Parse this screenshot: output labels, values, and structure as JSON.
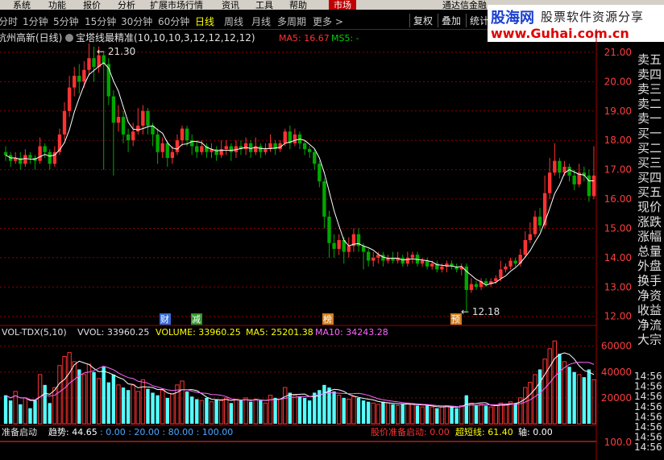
{
  "menu": {
    "items": [
      "系统",
      "功能",
      "报价",
      "分析",
      "扩展市场行情",
      "资讯",
      "工具",
      "帮助"
    ],
    "active_item": "市场",
    "account_text": "通达信金融"
  },
  "periods": {
    "items": [
      "分时",
      "1分钟",
      "5分钟",
      "15分钟",
      "30分钟",
      "60分钟",
      "日线",
      "周线",
      "月线",
      "多周期",
      "更多 >"
    ],
    "active": "日线"
  },
  "toolbar": {
    "buttons": [
      "复权",
      "叠加",
      "统计"
    ]
  },
  "logo": {
    "site": "股海网",
    "slogan": "股票软件资源分享",
    "url": "www.Guhai.com.cn"
  },
  "main": {
    "stock_title": "杭州高新(日线)",
    "indicator_name": "宝塔线最精准(10,10,10,3,12,12,12,12)",
    "ma5_text": "MA5: 16.67",
    "ms5_text": "MS5: -",
    "high_label": "21.30",
    "low_label": "12.18",
    "markers": [
      "财",
      "减",
      "榜",
      "预"
    ]
  },
  "vol": {
    "title": "VOL-TDX(5,10)",
    "vvol": "VVOL: 33960.25",
    "volume": "VOLUME: 33960.25",
    "ma5": "MA5: 25201.38",
    "ma10": "MA10: 34243.28"
  },
  "bottom": {
    "name": "准备启动",
    "trend": "趋势: 44.65",
    "levels": ": 0.00 : 20.00 : 80.00 : 100.00",
    "price_start": "股价准备启动: 0.00",
    "short_line": "超短线: 61.40",
    "axis": "轴: 0.00"
  },
  "sidebar": {
    "items": [
      "卖五",
      "卖四",
      "卖三",
      "卖二",
      "卖一",
      "买一",
      "买二",
      "买三",
      "买四",
      "买五",
      "现价",
      "涨跌",
      "涨幅",
      "总量",
      "外盘",
      "换手",
      "净资",
      "收益",
      "净流",
      "大宗"
    ],
    "times": [
      "14:56",
      "14:56",
      "14:56",
      "14:56",
      "14:56",
      "14:56",
      "14:56",
      "14:56"
    ]
  },
  "colors": {
    "up": "#ff3232",
    "down": "#00a800",
    "ma": "#ffffff",
    "grid": "#8b0000",
    "axis_text": "#ff3c3c",
    "vol_up": "#ff3232",
    "vol_down": "#54ffff"
  },
  "chart_data": {
    "type": "candlestick",
    "price_ticks": [
      21.0,
      20.0,
      19.0,
      18.0,
      17.0,
      16.0,
      15.0,
      14.0,
      13.0,
      12.0
    ],
    "price_range": [
      11.8,
      21.3
    ],
    "volume_ticks": [
      60000,
      40000,
      20000
    ],
    "volume_range": [
      0,
      66000
    ],
    "bottom_ticks": [
      "100.0"
    ],
    "candles": [
      [
        17.6,
        17.5,
        17.8,
        17.3
      ],
      [
        17.5,
        17.3,
        17.6,
        17.1
      ],
      [
        17.3,
        17.4,
        17.6,
        17.2
      ],
      [
        17.4,
        17.2,
        17.6,
        17.0
      ],
      [
        17.2,
        17.5,
        17.7,
        17.1
      ],
      [
        17.5,
        17.4,
        17.6,
        17.2
      ],
      [
        17.4,
        17.3,
        17.5,
        17.0
      ],
      [
        17.3,
        17.8,
        18.1,
        17.2
      ],
      [
        17.8,
        17.6,
        17.9,
        17.4
      ],
      [
        17.6,
        17.2,
        17.7,
        17.0
      ],
      [
        17.2,
        17.6,
        17.8,
        17.1
      ],
      [
        17.6,
        18.2,
        18.4,
        17.5
      ],
      [
        18.2,
        19.0,
        19.3,
        18.0
      ],
      [
        19.0,
        19.8,
        20.2,
        18.8
      ],
      [
        19.8,
        20.2,
        20.5,
        19.5
      ],
      [
        20.2,
        20.0,
        20.6,
        19.6
      ],
      [
        20.0,
        20.4,
        20.7,
        19.8
      ],
      [
        20.4,
        20.8,
        21.3,
        20.2
      ],
      [
        20.8,
        20.5,
        21.2,
        20.0
      ],
      [
        20.5,
        20.9,
        21.2,
        20.3
      ],
      [
        20.9,
        20.6,
        21.0,
        17.0
      ],
      [
        20.6,
        19.5,
        20.8,
        19.2
      ],
      [
        19.5,
        18.6,
        19.7,
        16.8
      ],
      [
        18.6,
        18.8,
        19.2,
        18.3
      ],
      [
        18.8,
        18.2,
        19.0,
        17.9
      ],
      [
        18.2,
        18.0,
        18.4,
        17.6
      ],
      [
        18.0,
        18.3,
        18.6,
        17.8
      ],
      [
        18.3,
        18.5,
        19.1,
        18.2
      ],
      [
        18.5,
        19.0,
        19.2,
        18.2
      ],
      [
        19.0,
        18.5,
        19.1,
        18.2
      ],
      [
        18.5,
        18.2,
        18.6,
        17.8
      ],
      [
        18.2,
        17.6,
        18.4,
        17.2
      ],
      [
        17.6,
        17.9,
        18.1,
        17.4
      ],
      [
        17.9,
        17.4,
        18.0,
        17.1
      ],
      [
        17.4,
        17.6,
        17.8,
        17.2
      ],
      [
        17.6,
        18.0,
        18.2,
        17.5
      ],
      [
        18.0,
        18.4,
        18.5,
        17.8
      ],
      [
        18.4,
        18.0,
        18.5,
        17.8
      ],
      [
        18.0,
        17.8,
        18.2,
        17.5
      ],
      [
        17.8,
        17.6,
        18.0,
        17.4
      ],
      [
        17.6,
        17.8,
        18.0,
        17.5
      ],
      [
        17.8,
        17.6,
        17.9,
        17.4
      ],
      [
        17.6,
        17.7,
        17.9,
        17.4
      ],
      [
        17.7,
        17.5,
        17.8,
        17.3
      ],
      [
        17.5,
        17.7,
        18.0,
        17.4
      ],
      [
        17.7,
        17.8,
        18.0,
        17.5
      ],
      [
        17.8,
        17.6,
        17.9,
        17.3
      ],
      [
        17.6,
        17.8,
        18.0,
        17.4
      ],
      [
        17.8,
        17.7,
        18.0,
        17.5
      ],
      [
        17.7,
        17.9,
        18.1,
        17.5
      ],
      [
        17.9,
        17.6,
        18.0,
        17.4
      ],
      [
        17.6,
        17.8,
        18.1,
        17.5
      ],
      [
        17.8,
        17.6,
        17.9,
        17.4
      ],
      [
        17.6,
        17.7,
        17.9,
        17.5
      ],
      [
        17.7,
        17.9,
        18.2,
        17.6
      ],
      [
        17.9,
        17.7,
        18.0,
        17.5
      ],
      [
        17.7,
        17.9,
        18.0,
        17.6
      ],
      [
        17.9,
        18.3,
        18.4,
        17.8
      ],
      [
        18.3,
        17.9,
        18.5,
        17.7
      ],
      [
        17.9,
        18.2,
        18.4,
        17.8
      ],
      [
        18.2,
        17.9,
        18.3,
        17.7
      ],
      [
        17.9,
        17.7,
        18.0,
        17.5
      ],
      [
        17.7,
        17.6,
        17.8,
        17.4
      ],
      [
        17.6,
        17.2,
        17.7,
        17.0
      ],
      [
        17.2,
        16.6,
        17.3,
        16.4
      ],
      [
        16.6,
        15.4,
        16.7,
        15.0
      ],
      [
        15.4,
        14.5,
        15.6,
        14.0
      ],
      [
        14.5,
        14.3,
        14.8,
        14.0
      ],
      [
        14.3,
        14.6,
        14.8,
        14.1
      ],
      [
        14.6,
        14.2,
        14.7,
        13.8
      ],
      [
        14.2,
        14.4,
        14.7,
        14.0
      ],
      [
        14.4,
        14.8,
        15.0,
        14.2
      ],
      [
        14.8,
        14.4,
        15.0,
        14.2
      ],
      [
        14.4,
        14.2,
        14.5,
        13.6
      ],
      [
        14.2,
        13.9,
        14.3,
        13.7
      ],
      [
        13.9,
        14.0,
        14.2,
        13.7
      ],
      [
        14.0,
        14.1,
        14.2,
        13.8
      ],
      [
        14.1,
        13.9,
        14.2,
        13.7
      ],
      [
        13.9,
        14.0,
        14.1,
        13.8
      ],
      [
        14.0,
        13.9,
        14.2,
        13.8
      ],
      [
        13.9,
        14.0,
        14.2,
        13.8
      ],
      [
        14.0,
        13.8,
        14.1,
        13.7
      ],
      [
        13.8,
        14.0,
        14.2,
        13.7
      ],
      [
        14.0,
        14.1,
        14.2,
        13.8
      ],
      [
        14.1,
        13.8,
        14.2,
        13.7
      ],
      [
        13.8,
        13.9,
        14.0,
        13.7
      ],
      [
        13.9,
        13.7,
        14.0,
        13.6
      ],
      [
        13.7,
        13.8,
        13.9,
        13.6
      ],
      [
        13.8,
        13.6,
        13.9,
        13.5
      ],
      [
        13.6,
        13.7,
        13.8,
        13.5
      ],
      [
        13.7,
        13.8,
        13.9,
        13.5
      ],
      [
        13.8,
        13.7,
        13.9,
        13.6
      ],
      [
        13.7,
        13.6,
        13.8,
        13.5
      ],
      [
        13.6,
        13.7,
        13.8,
        13.4
      ],
      [
        13.7,
        12.9,
        13.8,
        12.18
      ],
      [
        12.9,
        13.1,
        13.3,
        12.8
      ],
      [
        13.1,
        13.0,
        13.2,
        12.9
      ],
      [
        13.0,
        13.2,
        13.3,
        12.9
      ],
      [
        13.2,
        13.1,
        13.3,
        13.0
      ],
      [
        13.1,
        13.2,
        13.3,
        13.0
      ],
      [
        13.2,
        13.3,
        13.4,
        13.1
      ],
      [
        13.3,
        13.6,
        13.9,
        13.2
      ],
      [
        13.6,
        13.7,
        13.8,
        13.5
      ],
      [
        13.7,
        13.9,
        14.0,
        13.6
      ],
      [
        13.9,
        13.8,
        14.0,
        13.7
      ],
      [
        13.8,
        14.1,
        14.3,
        13.7
      ],
      [
        14.1,
        14.6,
        14.9,
        14.0
      ],
      [
        14.6,
        14.8,
        15.2,
        14.5
      ],
      [
        14.8,
        15.4,
        15.6,
        14.7
      ],
      [
        15.4,
        15.1,
        15.7,
        14.9
      ],
      [
        15.1,
        16.2,
        16.8,
        15.0
      ],
      [
        16.2,
        16.9,
        17.4,
        16.0
      ],
      [
        16.9,
        17.3,
        17.9,
        16.8
      ],
      [
        17.3,
        16.9,
        17.4,
        16.7
      ],
      [
        16.9,
        17.1,
        17.3,
        16.8
      ],
      [
        17.1,
        16.8,
        17.2,
        16.6
      ],
      [
        16.8,
        16.5,
        17.0,
        16.3
      ],
      [
        16.5,
        16.9,
        17.2,
        16.4
      ],
      [
        16.9,
        16.8,
        17.1,
        16.6
      ],
      [
        16.8,
        16.1,
        17.0,
        15.9
      ],
      [
        16.1,
        16.8,
        17.8,
        16.0
      ]
    ],
    "volumes": [
      22000,
      18000,
      25000,
      15000,
      20000,
      12000,
      18000,
      38000,
      30000,
      16000,
      28000,
      45000,
      52000,
      55000,
      48000,
      42000,
      38000,
      46000,
      40000,
      35000,
      44000,
      32000,
      38000,
      30000,
      28000,
      26000,
      30000,
      25000,
      34000,
      27000,
      24000,
      22000,
      26000,
      20000,
      23000,
      30000,
      33000,
      25000,
      21000,
      19000,
      18000,
      20000,
      17000,
      19000,
      18000,
      20000,
      16000,
      19000,
      18000,
      20000,
      17000,
      19000,
      18000,
      16000,
      22000,
      20000,
      19000,
      28000,
      24000,
      22000,
      21000,
      20000,
      18000,
      24000,
      26000,
      30000,
      28000,
      25000,
      22000,
      20000,
      19000,
      21000,
      20000,
      18000,
      17000,
      16000,
      15000,
      17000,
      16000,
      15000,
      14000,
      15000,
      16000,
      15000,
      14000,
      13000,
      14000,
      13000,
      12000,
      13000,
      14000,
      13000,
      12000,
      14000,
      22000,
      16000,
      14000,
      15000,
      14000,
      13000,
      14000,
      16000,
      15000,
      17000,
      16000,
      20000,
      28000,
      32000,
      38000,
      42000,
      50000,
      58000,
      64000,
      54000,
      48000,
      44000,
      40000,
      38000,
      36000,
      42000,
      34000
    ]
  }
}
